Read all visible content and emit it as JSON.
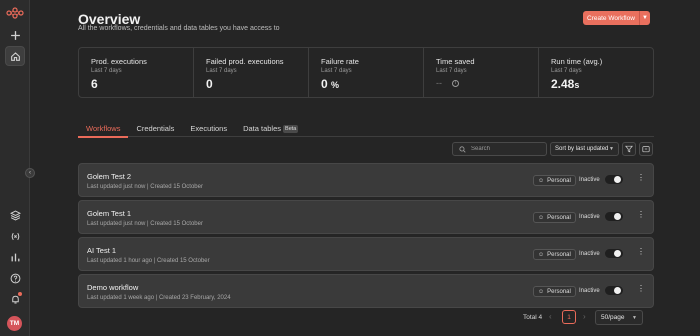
{
  "sidebar": {
    "logo": "n8n-logo",
    "icons": [
      "plus-icon",
      "home-icon",
      "templates-icon",
      "variables-icon",
      "insights-icon",
      "help-icon",
      "bell-icon"
    ],
    "avatar_initials": "TM"
  },
  "header": {
    "title": "Overview",
    "subtitle": "All the workflows, credentials and data tables you have access to",
    "create_button": "Create Workflow"
  },
  "stats": [
    {
      "label": "Prod. executions",
      "period": "Last 7 days",
      "value": "6",
      "unit": ""
    },
    {
      "label": "Failed prod. executions",
      "period": "Last 7 days",
      "value": "0",
      "unit": ""
    },
    {
      "label": "Failure rate",
      "period": "Last 7 days",
      "value": "0",
      "unit": "%"
    },
    {
      "label": "Time saved",
      "period": "Last 7 days",
      "value": "--",
      "unit": ""
    },
    {
      "label": "Run time (avg.)",
      "period": "Last 7 days",
      "value": "2.48",
      "unit": "s"
    }
  ],
  "tabs": [
    {
      "label": "Workflows",
      "active": true
    },
    {
      "label": "Credentials",
      "active": false
    },
    {
      "label": "Executions",
      "active": false
    },
    {
      "label": "Data tables",
      "active": false,
      "badge": "Beta"
    }
  ],
  "toolbar": {
    "search_placeholder": "Search",
    "sort_label": "Sort by last updated"
  },
  "workflows": [
    {
      "name": "Golem Test 2",
      "meta": "Last updated just now | Created 15 October",
      "badge": "Personal",
      "status": "Inactive"
    },
    {
      "name": "Golem Test 1",
      "meta": "Last updated just now | Created 15 October",
      "badge": "Personal",
      "status": "Inactive"
    },
    {
      "name": "AI Test 1",
      "meta": "Last updated 1 hour ago | Created 15 October",
      "badge": "Personal",
      "status": "Inactive"
    },
    {
      "name": "Demo workflow",
      "meta": "Last updated 1 week ago | Created 23 February, 2024",
      "badge": "Personal",
      "status": "Inactive"
    }
  ],
  "pagination": {
    "total": "Total 4",
    "page": "1",
    "page_size": "50/page"
  },
  "colors": {
    "accent": "#ea6b5a",
    "background": "#252525",
    "card": "#3a3a3a"
  }
}
